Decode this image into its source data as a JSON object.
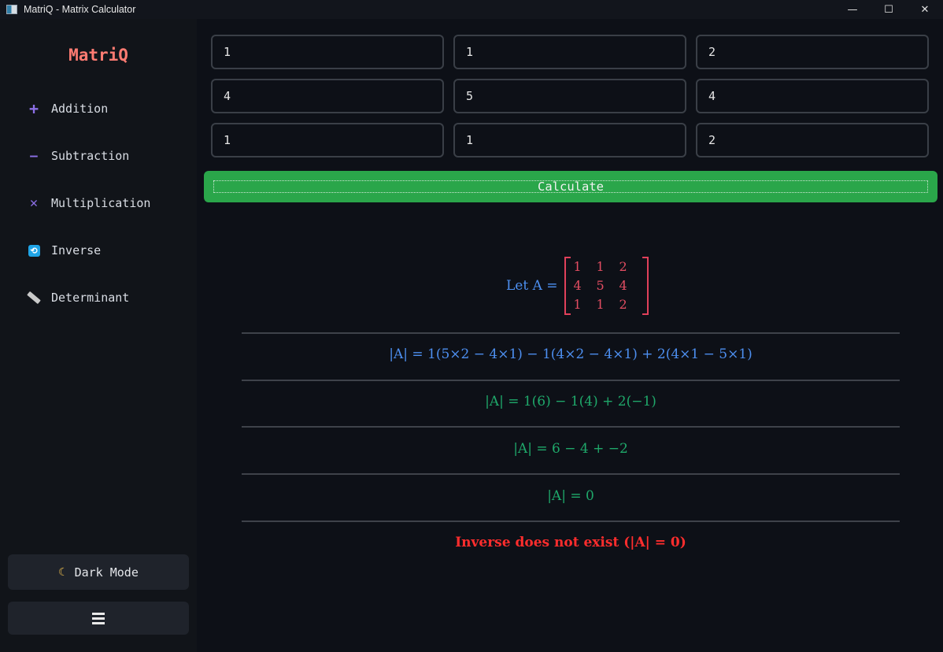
{
  "window": {
    "title": "MatriQ - Matrix Calculator",
    "controls": {
      "minimize": "—",
      "maximize": "☐",
      "close": "✕"
    }
  },
  "sidebar": {
    "brand": "MatriQ",
    "items": [
      {
        "label": "Addition",
        "icon": "plus-icon",
        "glyph": "+"
      },
      {
        "label": "Subtraction",
        "icon": "minus-icon",
        "glyph": "—"
      },
      {
        "label": "Multiplication",
        "icon": "multiply-icon",
        "glyph": "✕"
      },
      {
        "label": "Inverse",
        "icon": "inverse-icon",
        "glyph": "⟲"
      },
      {
        "label": "Determinant",
        "icon": "ruler-icon",
        "glyph": ""
      }
    ],
    "dark_mode_label": "Dark Mode",
    "moon_glyph": "☾"
  },
  "matrix_input": {
    "rows": [
      [
        "1",
        "1",
        "2"
      ],
      [
        "4",
        "5",
        "4"
      ],
      [
        "1",
        "1",
        "2"
      ]
    ]
  },
  "calculate_label": "Calculate",
  "result": {
    "let_label": "Let A =",
    "matrix": [
      [
        "1",
        "1",
        "2"
      ],
      [
        "4",
        "5",
        "4"
      ],
      [
        "1",
        "1",
        "2"
      ]
    ],
    "steps": [
      "|A| = 1(5×2 − 4×1) − 1(4×2 − 4×1) + 2(4×1 − 5×1)",
      "|A| = 1(6) − 1(4) + 2(−1)",
      "|A| = 6 − 4 + −2",
      "|A| = 0"
    ],
    "message": "Inverse does not exist (|A| = 0)"
  },
  "colors": {
    "brand": "#ff7b72",
    "accent_green": "#2aa64a",
    "step_blue": "#4d8ff0",
    "step_green": "#1fa86a",
    "error_red": "#ff2d2d",
    "matrix_red": "#e34d62"
  }
}
